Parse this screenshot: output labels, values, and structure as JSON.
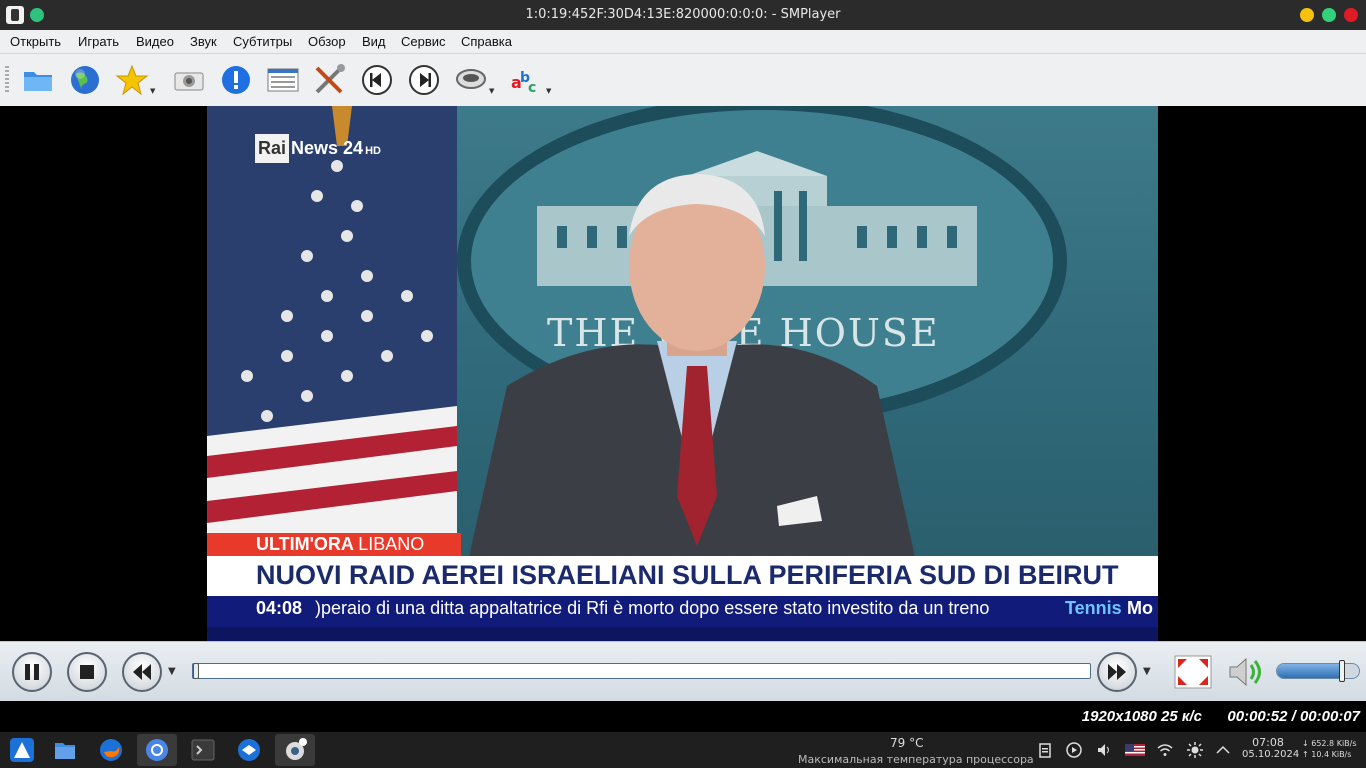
{
  "window": {
    "title": "1:0:19:452F:30D4:13E:820000:0:0:0: - SMPlayer"
  },
  "menu": [
    "Открыть",
    "Играть",
    "Видео",
    "Звук",
    "Субтитры",
    "Обзор",
    "Вид",
    "Сервис",
    "Справка"
  ],
  "toolbar": {
    "buttons": [
      "open-folder-icon",
      "globe-icon",
      "favorites-star-icon",
      "screenshot-camera-icon",
      "info-icon",
      "playlist-icon",
      "preferences-tools-icon",
      "previous-icon",
      "next-icon",
      "audio-track-icon",
      "subtitles-abc-icon"
    ]
  },
  "video": {
    "logo_rai": "Rai",
    "logo_news": "News 24",
    "logo_hd": "HD",
    "backdrop_text": "THE W   TE HOUSE",
    "red_label": "ULTIM'ORA",
    "red_sub": "LIBANO",
    "headline": "NUOVI RAID AEREI ISRAELIANI SULLA PERIFERIA SUD DI BEIRUT",
    "ticker_time": "04:08",
    "ticker_text": ")peraio di una ditta appaltatrice di Rfi è morto dopo essere stato investito da un treno",
    "ticker_next": "Tennis",
    "ticker_next2": "Mo"
  },
  "controls": {
    "buttons": [
      "pause-icon",
      "stop-icon",
      "rewind-icon",
      "forward-icon",
      "fullscreen-icon",
      "volume-icon"
    ],
    "seek_progress": 0.0,
    "volume_level": 0.79
  },
  "status": {
    "resolution": "1920x1080 25 к/с",
    "time": "00:00:52 / 00:00:07"
  },
  "taskbar": {
    "temperature": "79 °C",
    "temperature_label": "Максимальная температура процессора",
    "clock_time": "07:08",
    "clock_date": "05.10.2024",
    "net_down": "↓ 652.8 KiB/s",
    "net_up": "↑ 10.4 KiB/s"
  },
  "colors": {
    "accent_blue": "#3b82c9",
    "news_red": "#e83a2a",
    "news_blue": "#111b7a",
    "headline_text": "#1a2a6c"
  }
}
